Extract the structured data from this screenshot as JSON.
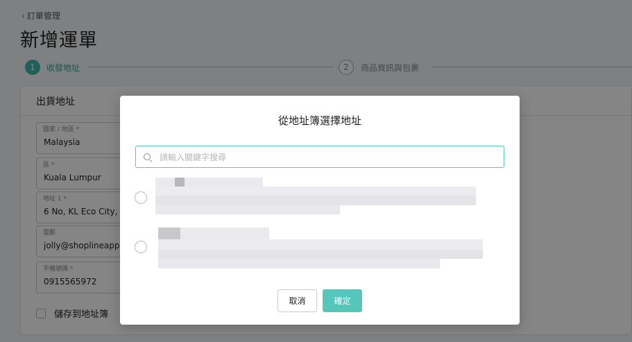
{
  "breadcrumb": {
    "back_label": "訂單管理"
  },
  "page": {
    "title": "新增運單"
  },
  "steps": [
    {
      "number": "1",
      "label": "收發地址"
    },
    {
      "number": "2",
      "label": "商品資訊與包裹"
    }
  ],
  "sender_card": {
    "title": "出貨地址",
    "fields": [
      {
        "label": "國家 / 地區 *",
        "value": "Malaysia"
      },
      {
        "label": "區 *",
        "value": "Kuala Lumpur"
      },
      {
        "label": "地址 1 *",
        "value": "6 No, KL Eco City,"
      },
      {
        "label": "電郵",
        "value": "jolly@shoplineapp."
      },
      {
        "label": "手機號碼 *",
        "value": "0915565972"
      }
    ],
    "save_checkbox_label": "儲存到地址簿"
  },
  "modal": {
    "title": "從地址簿選擇地址",
    "search": {
      "placeholder": "請輸入關鍵字搜尋",
      "value": ""
    },
    "cancel_label": "取消",
    "confirm_label": "確定"
  },
  "colors": {
    "accent": "#3fb8ab",
    "confirm_button": "#55c6bb"
  },
  "icons": {
    "back": "chevron-left-icon",
    "search": "search-icon"
  }
}
